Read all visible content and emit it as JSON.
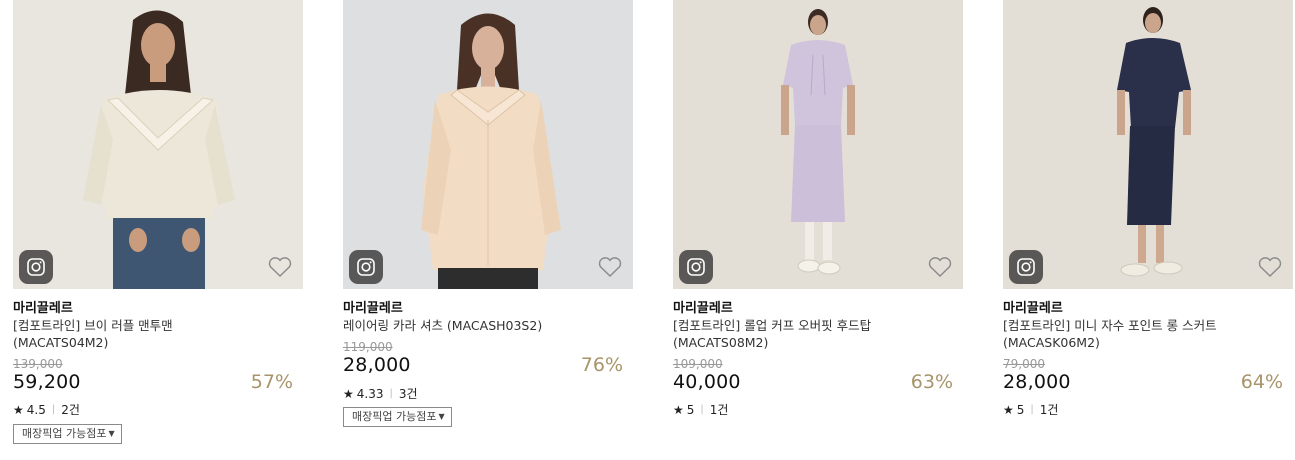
{
  "products": [
    {
      "brand": "마리끌레르",
      "name": "[컴포트라인] 브이 러플 맨투맨 (MACATS04M2)",
      "original_price": "139,000",
      "price": "59,200",
      "discount": "57%",
      "rating": "4.5",
      "reviews": "2건",
      "pickup_label": "매장픽업 가능점포",
      "photo_bg": "#e9e6df",
      "garment_color": "#ece7d8"
    },
    {
      "brand": "마리끌레르",
      "name": "레이어링 카라 셔츠 (MACASH03S2)",
      "original_price": "119,000",
      "price": "28,000",
      "discount": "76%",
      "rating": "4.33",
      "reviews": "3건",
      "pickup_label": "매장픽업 가능점포",
      "photo_bg": "#dedfe1",
      "garment_color": "#f2dcc3"
    },
    {
      "brand": "마리끌레르",
      "name": "[컴포트라인] 롤업 커프 오버핏 후드탑 (MACATS08M2)",
      "original_price": "109,000",
      "price": "40,000",
      "discount": "63%",
      "rating": "5",
      "reviews": "1건",
      "pickup_label": "",
      "photo_bg": "#e4dfd6",
      "garment_color": "#cfc4dc"
    },
    {
      "brand": "마리끌레르",
      "name": "[컴포트라인] 미니 자수 포인트 롱 스커트 (MACASK06M2)",
      "original_price": "79,000",
      "price": "28,000",
      "discount": "64%",
      "rating": "5",
      "reviews": "1건",
      "pickup_label": "",
      "photo_bg": "#e4dfd6",
      "garment_color": "#2a2f4a"
    }
  ],
  "icons": {
    "instagram": "instagram-icon",
    "wishlist": "heart-icon",
    "star": "star-icon",
    "dropdown": "caret-down-icon"
  }
}
